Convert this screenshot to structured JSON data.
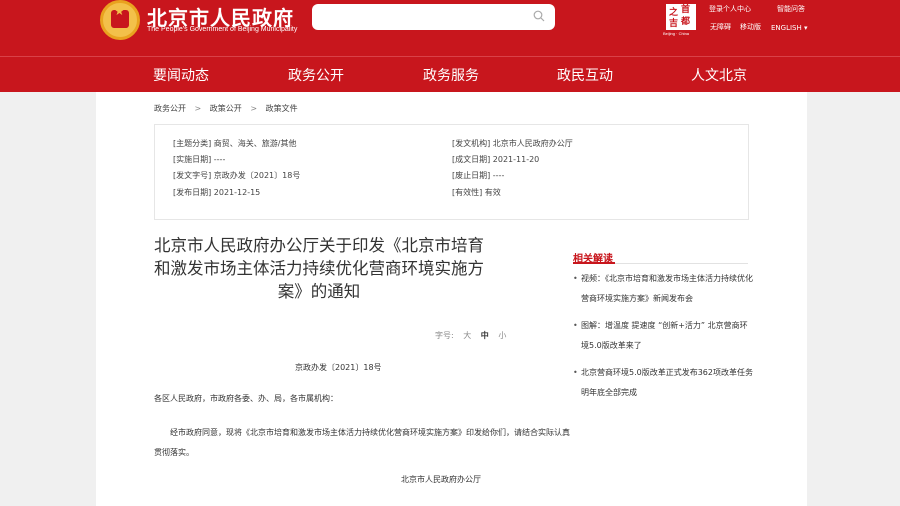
{
  "header": {
    "title": "北京市人民政府",
    "subtitle": "The People's Government of Beijing Municipality",
    "search_placeholder": "",
    "capital_logo_chars": [
      "首",
      "之",
      "都",
      "吉"
    ],
    "capital_logo_caption": "Beijing · China",
    "links": {
      "login": "登录个人中心",
      "smart_qa": "智能问答",
      "accessibility": "无障碍",
      "mobile": "移动版",
      "english": "ENGLISH ▾"
    }
  },
  "nav": [
    "要闻动态",
    "政务公开",
    "政务服务",
    "政民互动",
    "人文北京"
  ],
  "breadcrumb": [
    "政务公开",
    ">",
    "政策公开",
    ">",
    "政策文件"
  ],
  "info": {
    "topic": "[主题分类] 商贸、海关、旅游/其他",
    "impl_date": "[实施日期] ----",
    "doc_no": "[发文字号] 京政办发〔2021〕18号",
    "pub_date": "[发布日期] 2021-12-15",
    "issuer": "[发文机构] 北京市人民政府办公厅",
    "created": "[成文日期] 2021-11-20",
    "abolished": "[废止日期] ----",
    "validity": "[有效性] 有效"
  },
  "document": {
    "title": "北京市人民政府办公厅关于印发《北京市培育和激发市场主体活力持续优化营商环境实施方案》的通知",
    "font_label": "字号:",
    "font_large": "大",
    "font_medium": "中",
    "font_small": "小",
    "number": "京政办发〔2021〕18号",
    "recipients": "各区人民政府，市政府各委、办、局，各市属机构：",
    "body": "经市政府同意，现将《北京市培育和激发市场主体活力持续优化营商环境实施方案》印发给你们，请结合实际认真贯彻落实。",
    "issuer": "北京市人民政府办公厅"
  },
  "related": {
    "title": "相关解读",
    "items": [
      "视频：《北京市培育和激发市场主体活力持续优化营商环境实施方案》新闻发布会",
      "图解：增温度 提速度 “创新+活力” 北京营商环境5.0版改革来了",
      "北京营商环境5.0版改革正式发布362项改革任务明年底全部完成"
    ]
  },
  "colors": {
    "brand_red": "#c8161d",
    "emblem_gold": "#f3c04a"
  }
}
